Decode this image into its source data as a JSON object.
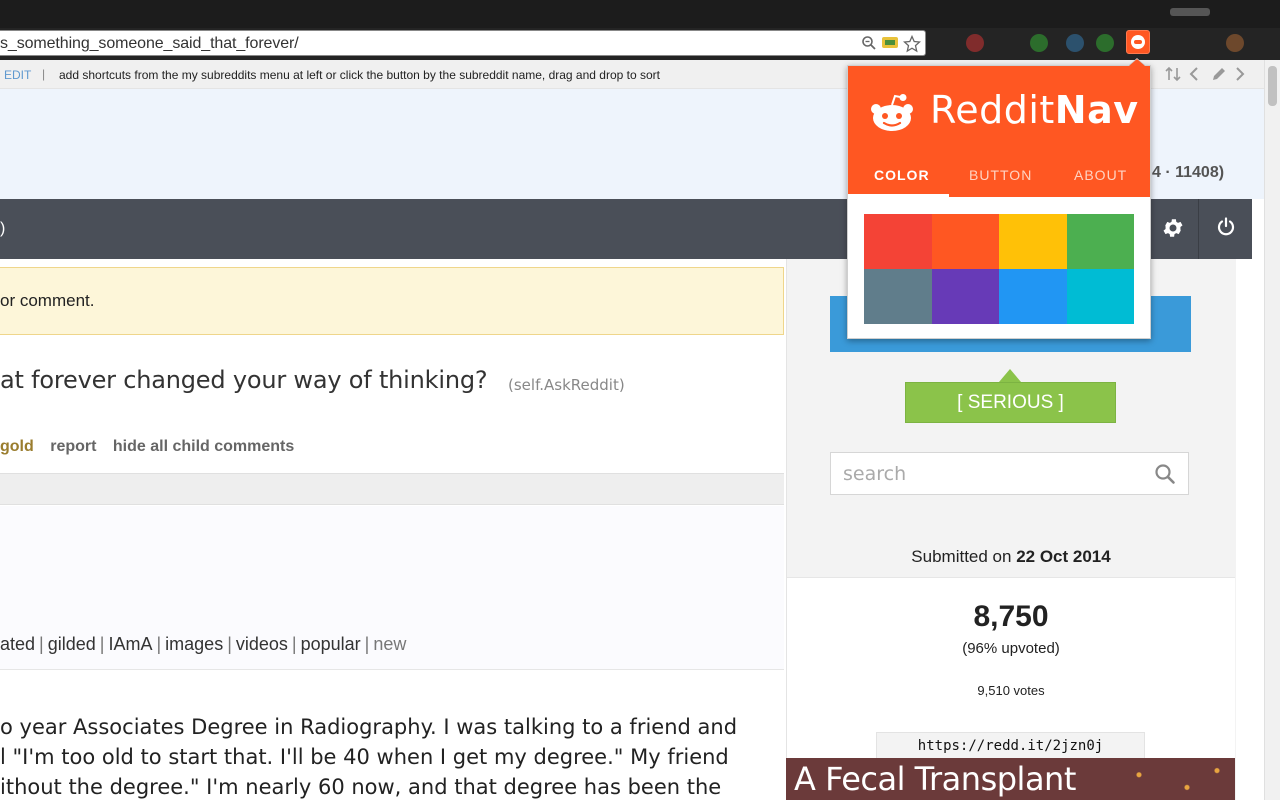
{
  "browser": {
    "url": "s_something_someone_said_that_forever/"
  },
  "subreddit_bar": {
    "edit": "EDIT",
    "separator": "|",
    "tip": "add shortcuts from the my subreddits menu at left or click the button by the subreddit name, drag and drop to sort"
  },
  "header": {
    "karma": "4 · 11408)"
  },
  "darkbar": {
    "left_text": ")"
  },
  "notice": {
    "text": "or comment."
  },
  "post": {
    "title": "at forever changed your way of thinking?",
    "domain": "(self.AskReddit)",
    "actions": {
      "gold": "gold",
      "report": "report",
      "hide": "hide all child comments"
    }
  },
  "sort_links": {
    "items": [
      "ated",
      "gilded",
      "IAmA",
      "images",
      "videos",
      "popular"
    ],
    "current": "new"
  },
  "comment": {
    "lines": [
      "o year Associates Degree in Radiography. I was talking to a friend and",
      "l \"I'm too old to start that. I'll be 40 when I get my degree.\" My friend",
      "ithout the degree.\" I'm nearly 60 now, and that degree has been the"
    ]
  },
  "sidebar": {
    "serious": "[ SERIOUS ]",
    "search_placeholder": "search",
    "submitted_prefix": "Submitted on ",
    "submitted_date": "22 Oct 2014",
    "score": "8,750",
    "upvoted": "(96% upvoted)",
    "votes": "9,510 votes",
    "shortlink": "https://redd.it/2jzn0j",
    "ad_text": "A Fecal Transplant"
  },
  "popup": {
    "logo_regular": "Reddit",
    "logo_bold": "Nav",
    "tabs": [
      "COLOR",
      "BUTTON",
      "ABOUT"
    ],
    "active_tab": "COLOR",
    "swatches": [
      "#f44336",
      "#ff5722",
      "#ffc107",
      "#4caf50",
      "#607d8b",
      "#673ab7",
      "#2196f3",
      "#00bcd4"
    ]
  },
  "colors": {
    "accent": "#ff5722",
    "dark_bar": "#4a4f58",
    "serious": "#8bc34a",
    "link_blue": "#5f99cf"
  }
}
